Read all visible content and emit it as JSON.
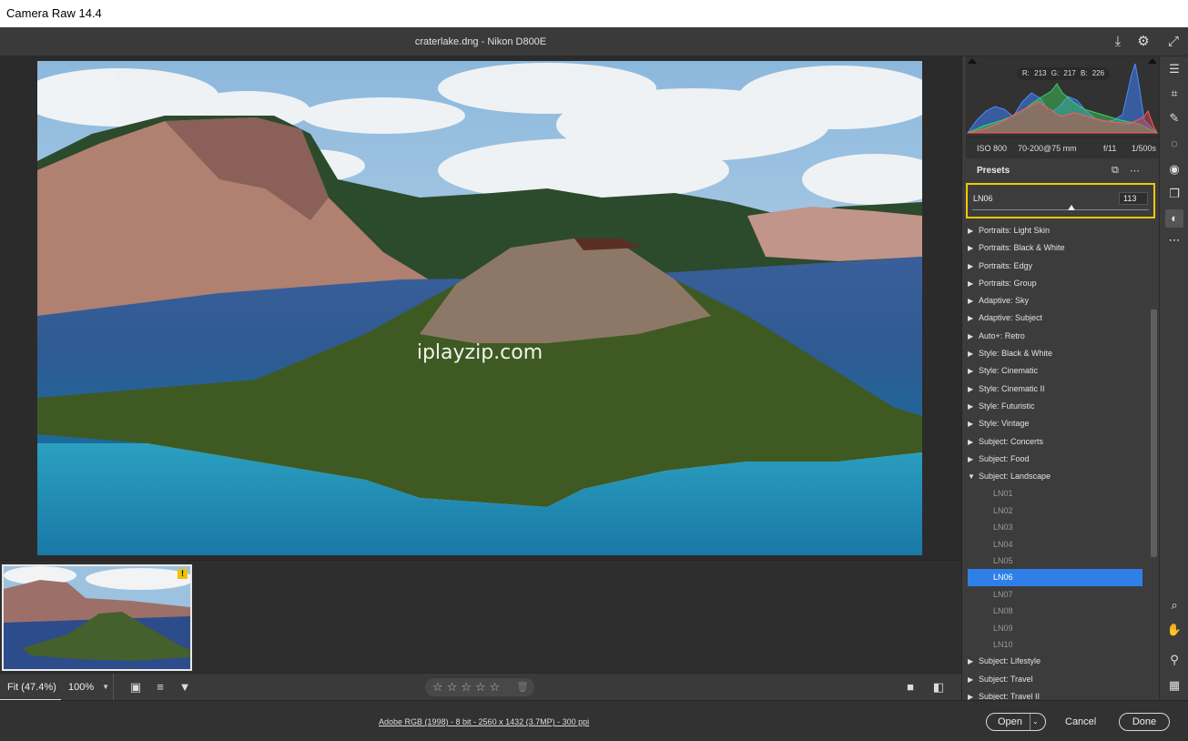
{
  "app": {
    "title": "Camera Raw 14.4"
  },
  "header": {
    "filename": "craterlake.dng  -  Nikon D800E"
  },
  "image": {
    "watermark": "iplayzip.com"
  },
  "histogram": {
    "readout": "R: 213  G: 217  B: 226",
    "iso": "ISO 800",
    "lens": "70-200@75 mm",
    "aperture": "f/11",
    "shutter": "1/500s"
  },
  "presets": {
    "title": "Presets",
    "amount_name": "LN06",
    "amount_value": "113",
    "amount_level": 0.56,
    "groups": [
      {
        "label": "Portraits: Light Skin",
        "expanded": false
      },
      {
        "label": "Portraits: Black & White",
        "expanded": false
      },
      {
        "label": "Portraits: Edgy",
        "expanded": false
      },
      {
        "label": "Portraits: Group",
        "expanded": false
      },
      {
        "label": "Adaptive: Sky",
        "expanded": false
      },
      {
        "label": "Adaptive: Subject",
        "expanded": false
      },
      {
        "label": "Auto+: Retro",
        "expanded": false
      },
      {
        "label": "Style: Black & White",
        "expanded": false
      },
      {
        "label": "Style: Cinematic",
        "expanded": false
      },
      {
        "label": "Style: Cinematic II",
        "expanded": false
      },
      {
        "label": "Style: Futuristic",
        "expanded": false
      },
      {
        "label": "Style: Vintage",
        "expanded": false
      },
      {
        "label": "Subject: Concerts",
        "expanded": false
      },
      {
        "label": "Subject: Food",
        "expanded": false
      },
      {
        "label": "Subject: Landscape",
        "expanded": true,
        "items": [
          "LN01",
          "LN02",
          "LN03",
          "LN04",
          "LN05",
          "LN06",
          "LN07",
          "LN08",
          "LN09",
          "LN10"
        ],
        "selected": "LN06"
      },
      {
        "label": "Subject: Lifestyle",
        "expanded": false
      },
      {
        "label": "Subject: Travel",
        "expanded": false
      },
      {
        "label": "Subject: Travel II",
        "expanded": false
      }
    ]
  },
  "toolbar": {
    "fit": "Fit (47.4%)",
    "zoom": "100%",
    "stars": "☆☆☆☆☆"
  },
  "status": {
    "workflow": "Adobe RGB (1998) - 8 bit - 2560 x 1432 (3.7MP) - 300 ppi",
    "open": "Open",
    "cancel": "Cancel",
    "done": "Done"
  },
  "colors": {
    "accent": "#2e80e8",
    "highlight": "#f0c808"
  }
}
